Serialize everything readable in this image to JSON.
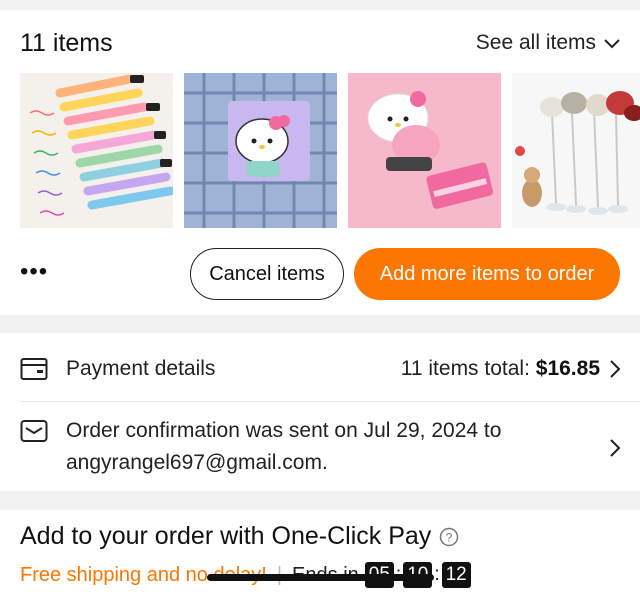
{
  "items_section": {
    "count_label": "11 items",
    "see_all_label": "See all items",
    "thumbnails": [
      {
        "name": "pens-thumbnail"
      },
      {
        "name": "hello-kitty-notepad-thumbnail"
      },
      {
        "name": "hello-kitty-stapler-thumbnail"
      },
      {
        "name": "cat-toy-thumbnail"
      }
    ],
    "more_label": "•••",
    "cancel_label": "Cancel items",
    "add_more_label": "Add more items to order"
  },
  "payment": {
    "label": "Payment details",
    "total_prefix": "11 items total: ",
    "total_value": "$16.85"
  },
  "confirmation": {
    "line1": "Order confirmation was sent on Jul 29, 2024 to",
    "line2": "angyrangel697@gmail.com."
  },
  "one_click": {
    "title": "Add to your order with One-Click Pay",
    "free_shipping": "Free shipping and no delay!",
    "separator": "|",
    "ends_in": "Ends in",
    "timer": [
      "05",
      "10",
      "12"
    ]
  },
  "colors": {
    "accent": "#fb7701",
    "text": "#222222",
    "background": "#f2f2f2"
  }
}
